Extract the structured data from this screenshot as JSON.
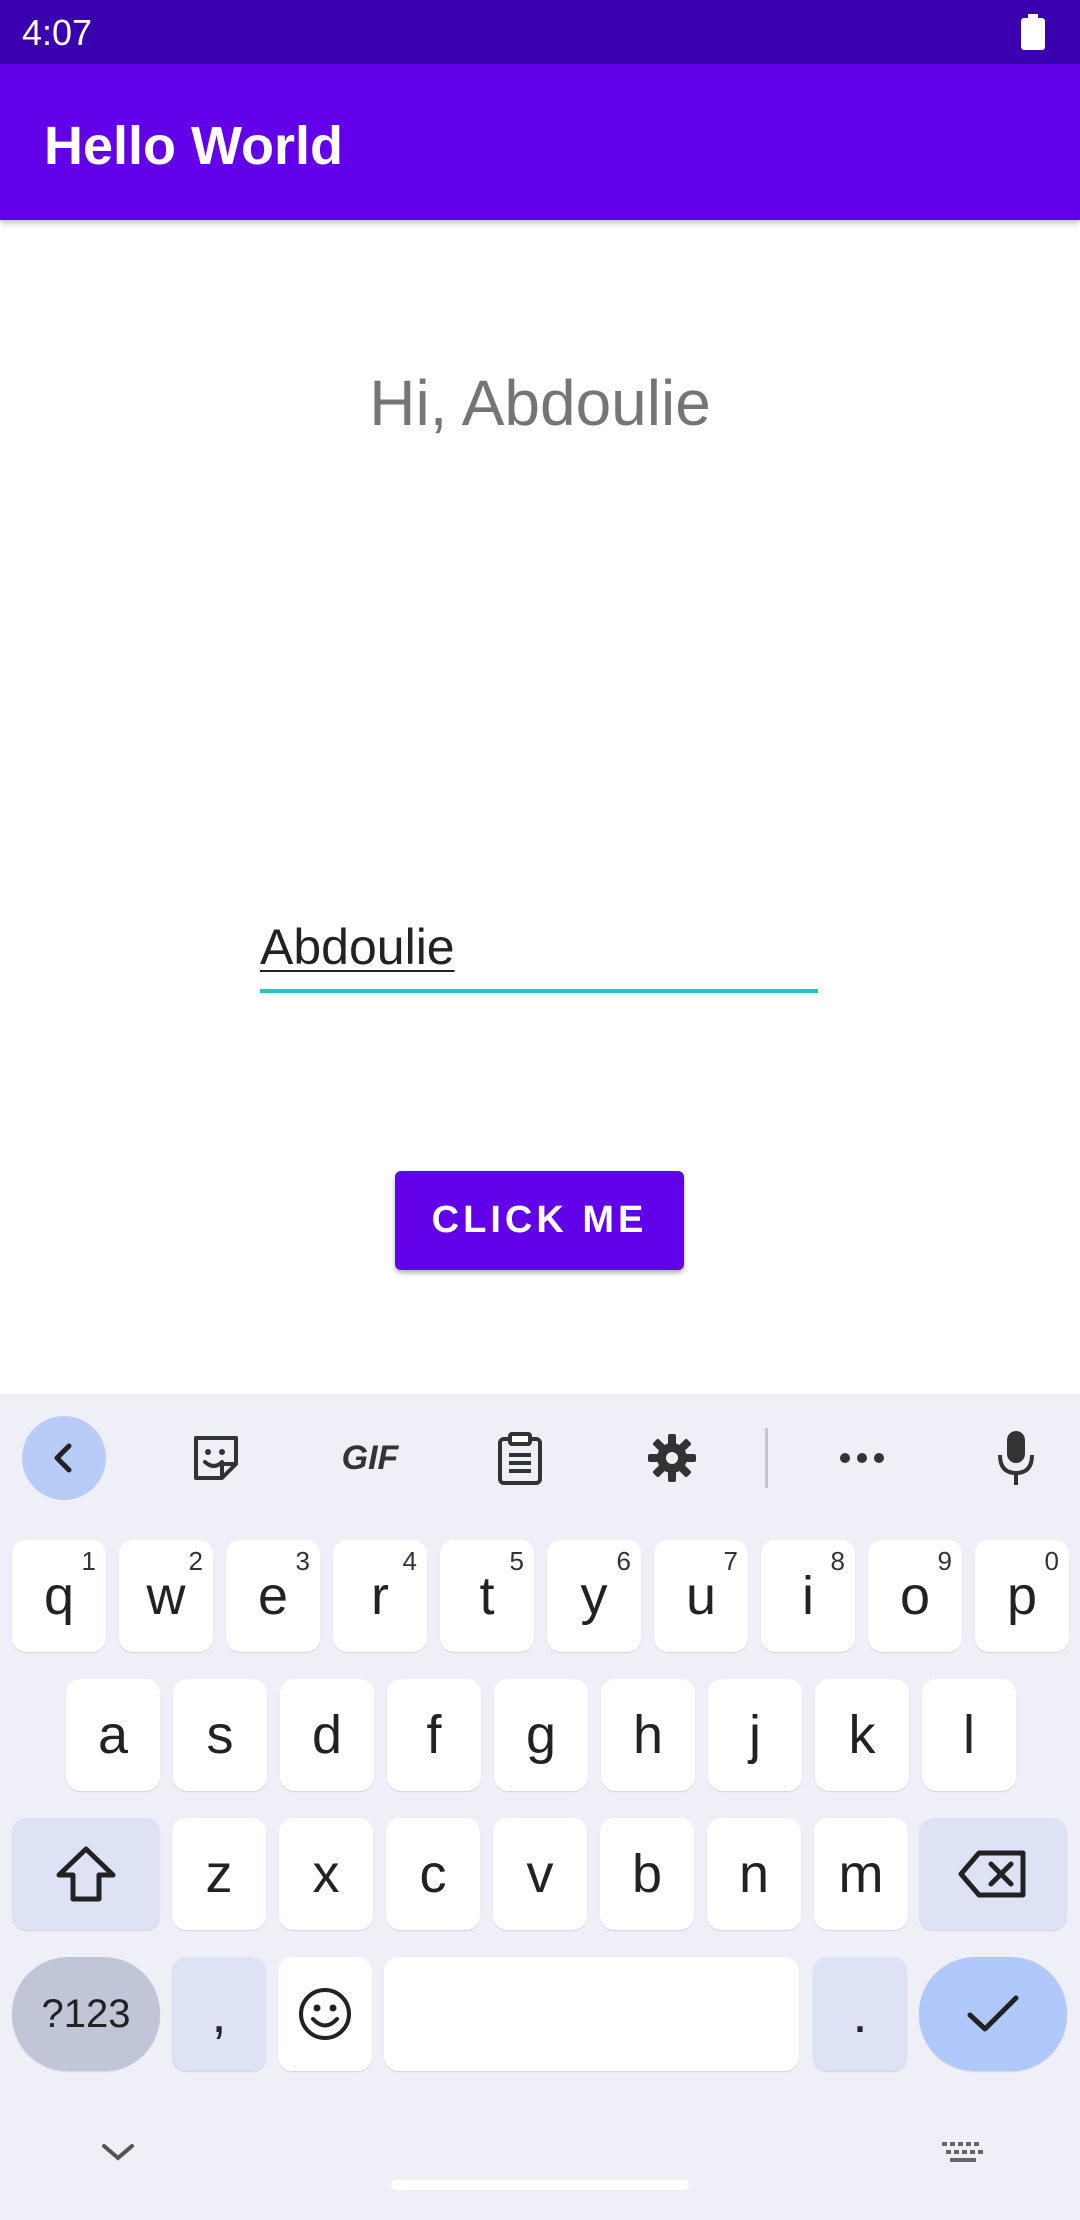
{
  "status_bar": {
    "time": "4:07",
    "battery_icon": "battery-full-icon"
  },
  "app_bar": {
    "title": "Hello World"
  },
  "main": {
    "greeting": "Hi, Abdoulie",
    "name_input_value": "Abdoulie",
    "button_label": "CLICK ME"
  },
  "keyboard": {
    "toolbar": [
      "back-arrow-icon",
      "sticker-icon",
      "gif-icon",
      "clipboard-icon",
      "settings-icon",
      "more-icon",
      "mic-icon"
    ],
    "gif_label": "GIF",
    "row1": [
      {
        "key": "q",
        "sup": "1"
      },
      {
        "key": "w",
        "sup": "2"
      },
      {
        "key": "e",
        "sup": "3"
      },
      {
        "key": "r",
        "sup": "4"
      },
      {
        "key": "t",
        "sup": "5"
      },
      {
        "key": "y",
        "sup": "6"
      },
      {
        "key": "u",
        "sup": "7"
      },
      {
        "key": "i",
        "sup": "8"
      },
      {
        "key": "o",
        "sup": "9"
      },
      {
        "key": "p",
        "sup": "0"
      }
    ],
    "row2": [
      "a",
      "s",
      "d",
      "f",
      "g",
      "h",
      "j",
      "k",
      "l"
    ],
    "row3": [
      "z",
      "x",
      "c",
      "v",
      "b",
      "n",
      "m"
    ],
    "sym_label": "?123",
    "comma": ",",
    "period": "."
  },
  "colors": {
    "status_bar": "#3a00b0",
    "app_bar": "#6200ea",
    "input_underline": "#1ec8c0",
    "keyboard_bg": "#eff0f7"
  }
}
